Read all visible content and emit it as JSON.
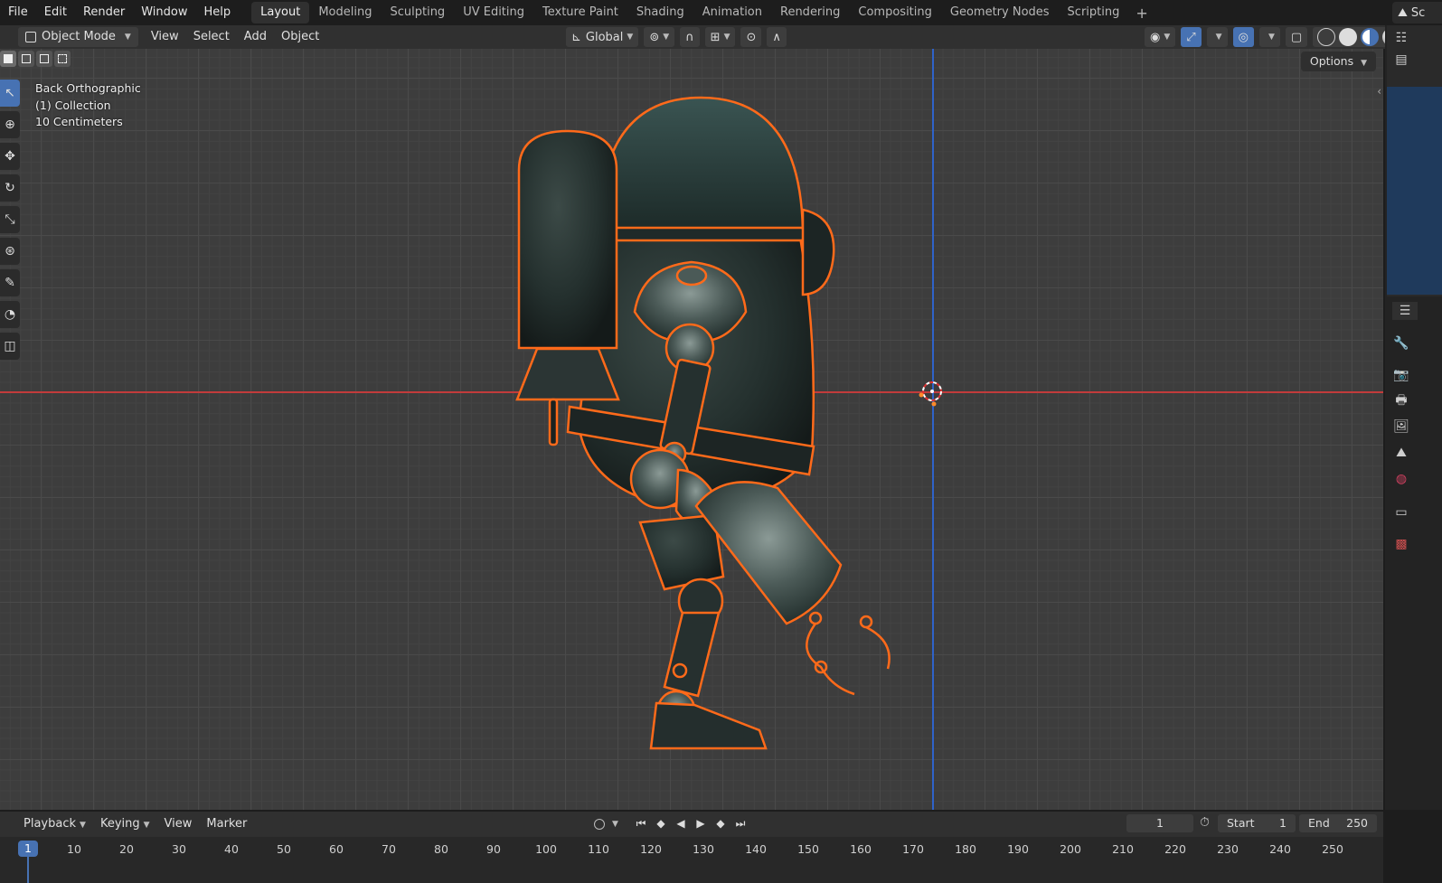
{
  "menu": {
    "file": "File",
    "edit": "Edit",
    "render": "Render",
    "window": "Window",
    "help": "Help"
  },
  "workspaces": [
    "Layout",
    "Modeling",
    "Sculpting",
    "UV Editing",
    "Texture Paint",
    "Shading",
    "Animation",
    "Rendering",
    "Compositing",
    "Geometry Nodes",
    "Scripting"
  ],
  "active_workspace": "Layout",
  "scene_label": "Sc",
  "viewport_header": {
    "mode": "Object Mode",
    "view": "View",
    "select": "Select",
    "add": "Add",
    "object": "Object",
    "orientation": "Global"
  },
  "viewport": {
    "view_name": "Back Orthographic",
    "collection": "(1) Collection",
    "scale": "10 Centimeters",
    "options": "Options"
  },
  "timeline": {
    "playback": "Playback",
    "keying": "Keying",
    "view": "View",
    "marker": "Marker",
    "current_frame": "1",
    "start_label": "Start",
    "start": "1",
    "end_label": "End",
    "end": "250",
    "cursor_frame": "1",
    "ticks": [
      "10",
      "20",
      "30",
      "40",
      "50",
      "60",
      "70",
      "80",
      "90",
      "100",
      "110",
      "120",
      "130",
      "140",
      "150",
      "160",
      "170",
      "180",
      "190",
      "200",
      "210",
      "220",
      "230",
      "240",
      "250"
    ]
  },
  "colors": {
    "accent": "#4772b3",
    "selection": "#ff6a1a",
    "x_axis": "#c23b3b",
    "z_axis": "#2f63c9"
  }
}
